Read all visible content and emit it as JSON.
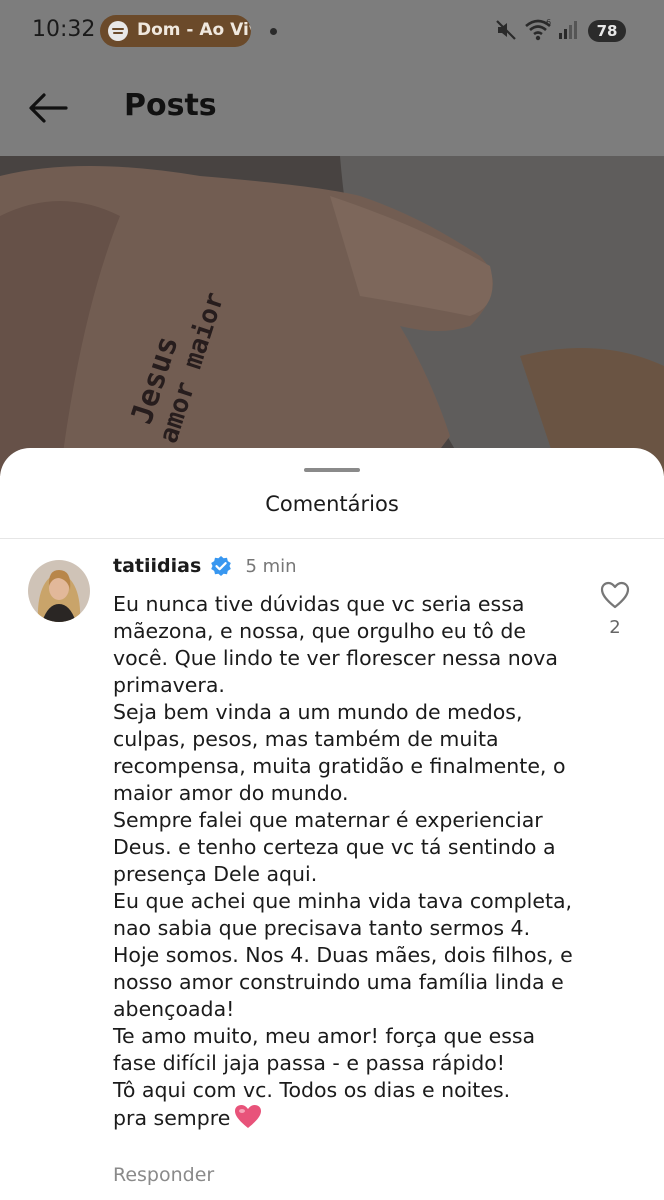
{
  "status_bar": {
    "time": "10:32",
    "now_playing": "Dom - Ao Vivo",
    "battery": "78",
    "icons": [
      "spotify-icon",
      "mute-icon",
      "wifi-6-icon",
      "signal-icon",
      "battery-icon"
    ]
  },
  "header": {
    "title": "Posts",
    "back_icon": "arrow-left-icon"
  },
  "post": {
    "tattoo_text": "Jesus amor maior"
  },
  "comments_sheet": {
    "title": "Comentários",
    "comment": {
      "username": "tatiidias",
      "time": "5 min",
      "paragraphs": [
        "Eu nunca tive dúvidas que vc seria essa mãezona, e nossa, que orgulho eu tô de você. Que lindo te ver florescer nessa nova primavera.",
        "Seja bem vinda a um mundo de medos, culpas, pesos, mas também de muita recompensa, muita gratidão e finalmente, o maior amor do mundo.",
        "Sempre falei que maternar é experienciar Deus. e tenho certeza que vc tá sentindo a presença Dele aqui.",
        "Eu que achei que minha vida tava completa, nao sabia que precisava tanto sermos 4.",
        "Hoje somos. Nos 4. Duas mães, dois filhos, e nosso amor construindo uma família linda e abençoada!",
        "Te amo muito, meu amor! força que essa fase difícil jaja passa - e passa rápido!",
        "Tô aqui com vc. Todos os dias e noites.",
        "pra sempre"
      ],
      "likes": "2",
      "reply_label": "Responder"
    }
  },
  "colors": {
    "dim_overlay": "#7d7d7d",
    "verified_blue": "#3897f0",
    "heart_pink": "#e8537a",
    "pill_brown": "#6b4a2a"
  }
}
